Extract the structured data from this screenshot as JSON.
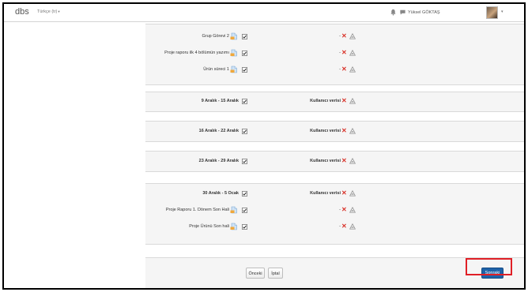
{
  "header": {
    "brand": "dbs",
    "language": "Türkçe (tr)",
    "user_name": "Yüksel GÖKTAŞ",
    "icons": [
      "bell-icon",
      "chat-icon",
      "avatar",
      "chevron-down-icon"
    ]
  },
  "blocks": [
    {
      "rows": [
        {
          "label": "Grup Görevi 2",
          "file_icon": true,
          "mid": "-",
          "bold": false
        },
        {
          "label": "Proje raporu ilk 4 bölümün yazımı",
          "file_icon": true,
          "mid": "-",
          "bold": false
        },
        {
          "label": "Ürün süreci 1",
          "file_icon": true,
          "mid": "-",
          "bold": false
        }
      ]
    },
    {
      "rows": [
        {
          "label": "9 Aralık - 15 Aralık",
          "file_icon": false,
          "mid": "Kullanıcı verisi",
          "bold": true
        }
      ]
    },
    {
      "rows": [
        {
          "label": "16 Aralık - 22 Aralık",
          "file_icon": false,
          "mid": "Kullanıcı verisi",
          "bold": true
        }
      ]
    },
    {
      "rows": [
        {
          "label": "23 Aralık - 29 Aralık",
          "file_icon": false,
          "mid": "Kullanıcı verisi",
          "bold": true
        }
      ]
    },
    {
      "rows": [
        {
          "label": "30 Aralık - 5 Ocak",
          "file_icon": false,
          "mid": "Kullanıcı verisi",
          "bold": true
        },
        {
          "label": "Proje Raporu 1. Dönem Son Hali",
          "file_icon": true,
          "mid": "-",
          "bold": false
        },
        {
          "label": "Proje Ürünü Son hali",
          "file_icon": true,
          "mid": "-",
          "bold": false
        }
      ]
    }
  ],
  "row_icons": {
    "delete": "x-icon",
    "warning": "warning-icon",
    "checkbox": "checkbox-checked"
  },
  "footer": {
    "prev_label": "Önceki",
    "cancel_label": "İptal",
    "next_label": "Sonraki"
  },
  "colors": {
    "delete": "#d9342b",
    "primary_button": "#1f63a9",
    "highlight": "#e01f26"
  }
}
